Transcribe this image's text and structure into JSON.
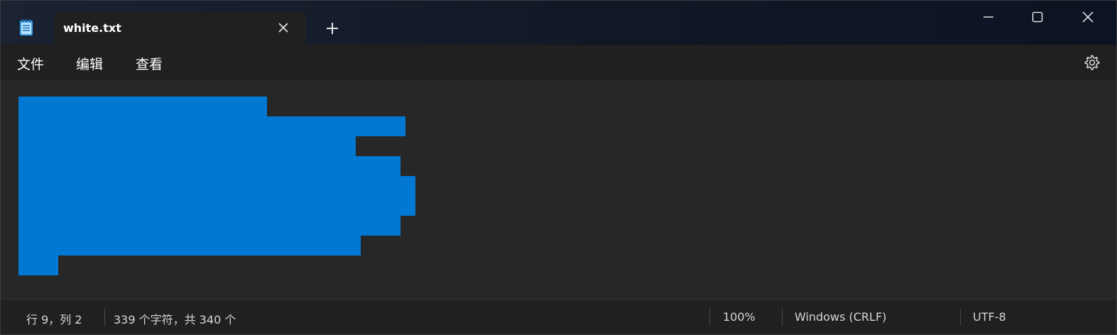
{
  "window": {
    "tab_title": "white.txt",
    "new_tab_symbol": "+",
    "icons": [
      "notepad-app-icon",
      "close-tab-icon",
      "plus-icon",
      "minimize-icon",
      "maximize-icon",
      "close-icon",
      "gear-icon"
    ]
  },
  "menu": {
    "file": "文件",
    "edit": "编辑",
    "view": "查看"
  },
  "editor": {
    "selection_color": "#0078d4"
  },
  "status": {
    "position": "行 9，列 2",
    "char_count": "339 个字符，共 340 个",
    "zoom": "100%",
    "line_ending": "Windows (CRLF)",
    "encoding": "UTF-8"
  },
  "colors": {
    "accent": "#0078d4",
    "background": "#272727",
    "menubar": "#202020"
  }
}
